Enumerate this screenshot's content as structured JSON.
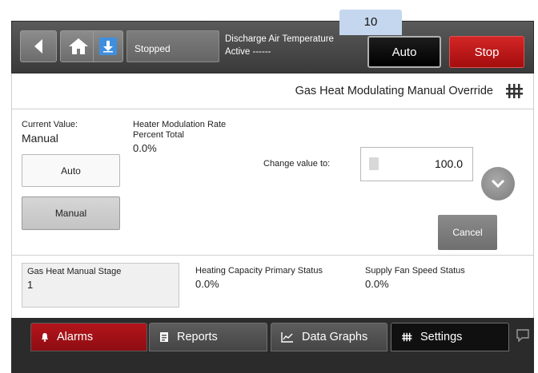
{
  "step_tab": "10",
  "topbar": {
    "unit_status": "Stopped",
    "point_name": "Discharge Air Temperature",
    "point_status": "Active ------",
    "auto_label": "Auto",
    "stop_label": "Stop"
  },
  "page": {
    "title": "Gas Heat Modulating Manual Override"
  },
  "override": {
    "current_value_label": "Current Value:",
    "current_value": "Manual",
    "auto_button": "Auto",
    "manual_button": "Manual",
    "point_label_line1": "Heater Modulation Rate",
    "point_label_line2": "Percent Total",
    "point_value": "0.0%",
    "change_label": "Change value to:",
    "change_value": "100.0",
    "cancel_label": "Cancel"
  },
  "status": {
    "manual_stage_label": "Gas Heat Manual Stage",
    "manual_stage_value": "1",
    "heating_capacity_label": "Heating Capacity Primary Status",
    "heating_capacity_value": "0.0%",
    "fan_speed_label": "Supply Fan Speed Status",
    "fan_speed_value": "0.0%"
  },
  "nav": {
    "alarms": "Alarms",
    "reports": "Reports",
    "data_graphs": "Data Graphs",
    "settings": "Settings"
  },
  "colors": {
    "stop": "#c4181c",
    "alarms": "#a11218",
    "accent_blue": "#3f8fde",
    "step_tab": "#c5d7ee"
  }
}
